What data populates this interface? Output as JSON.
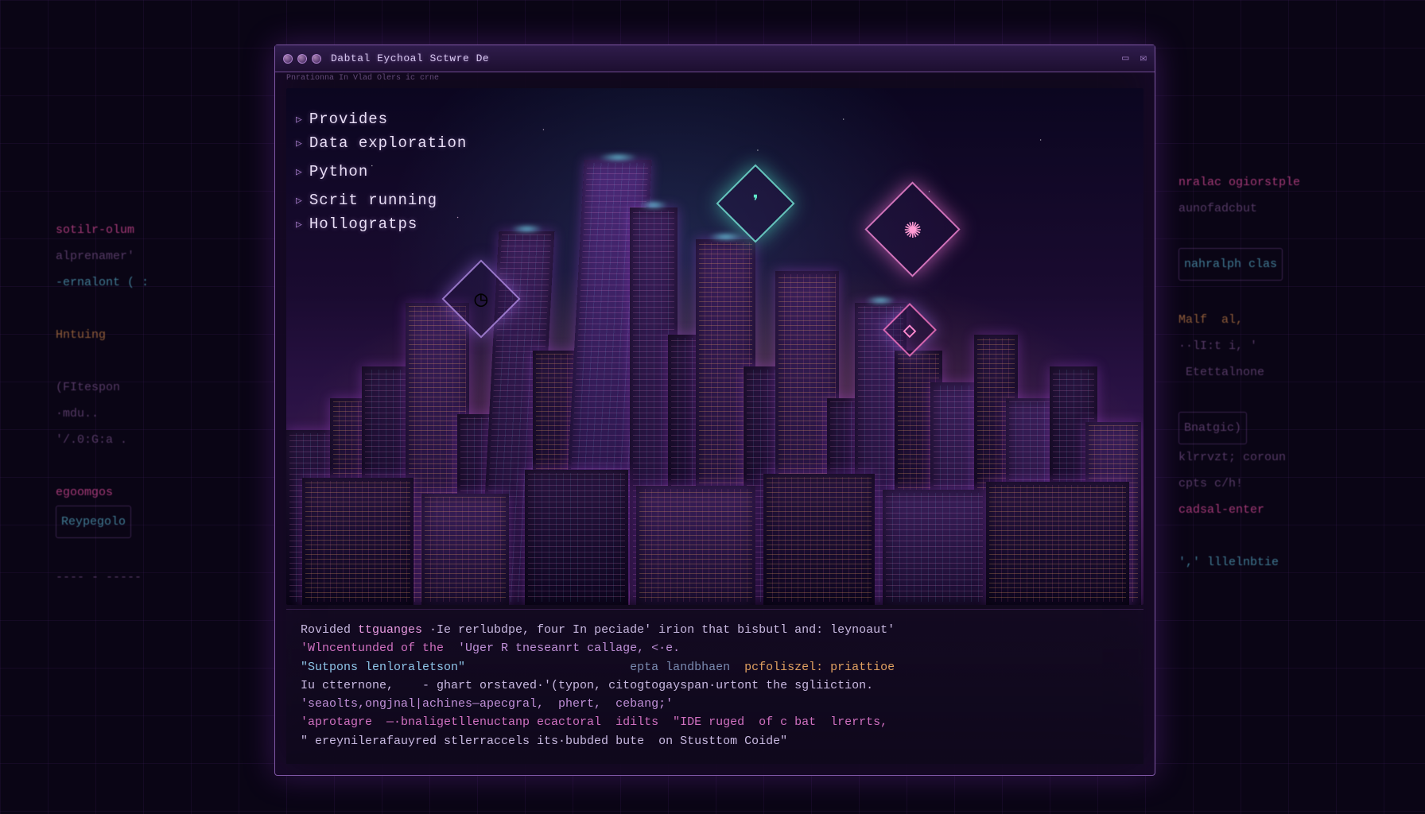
{
  "window": {
    "title": "Dabtal  Eychoal  Sctwre  De",
    "subtitle": "Pnrationna  In  Vlad  Olers  ic  crne"
  },
  "sidebar": {
    "items": [
      {
        "label": "Provides"
      },
      {
        "label": "Data exploration"
      },
      {
        "label": "Python"
      },
      {
        "label": "Scrit running"
      },
      {
        "label": "Hollogratps"
      }
    ]
  },
  "terminal": {
    "lines": [
      {
        "pre": "Rovided ",
        "kw": "ttguanges",
        "mid": " ·Ie rerlubdpe, four In peciade' irion that bisbutl and: leynoaut'"
      },
      {
        "pre": "'Wlncentunded of the  ",
        "kw": "'Uger R tneseanrt callage, <·e."
      },
      {
        "pre": "\"Sutpons lenloraletson\"",
        "right_cmt": "epta landbhaen",
        "right_kw": "pcfoliszel: priattioe"
      },
      {
        "pre": "Iu ctternone,    - ghart orstaved·'(typon, citogtogayspan·urtont the sgliiction."
      },
      {
        "pre": "'seaolts,ongjnal|achines—apecgral,  phert,  cebang;'"
      },
      {
        "pre": "'aprotagre  —·bnaligetllenuctanp ecactoral  idilts  \"IDE ruged  of c bat  lrerrts,"
      },
      {
        "pre": "\" ereynilerafauyred stlerraccels its·bubded bute  on Stusttom Coide\""
      }
    ]
  },
  "bg_code_left": [
    "sotilr-olum",
    "alprenamer'",
    "-ernalont ( :",
    "",
    "Hntuing",
    "",
    "(FItespon",
    "·mdu..",
    "'/.0:G:a .",
    "",
    "egoomgos",
    "Reypegolo",
    "",
    "---- - -----"
  ],
  "bg_code_right": [
    "nralac ogiorstple",
    "aunofadcbut",
    "",
    "nahralph clas",
    "",
    "Malf  al,",
    "··lI:t i, '",
    " Etettalnone",
    "",
    "Bnatgic)",
    "klrrvzt; coroun",
    "cpts c/h!",
    "cadsal-enter",
    "",
    "',' lllelnbtie"
  ],
  "icons": {
    "clock": "◷",
    "leaf": "❜",
    "atom": "✺",
    "paper": "◇"
  }
}
